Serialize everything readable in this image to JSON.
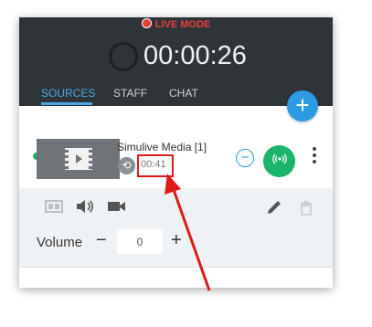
{
  "live_mode": {
    "label": "LIVE MODE",
    "color": "#e8403a"
  },
  "timer": {
    "value": "00:00:26"
  },
  "tabs": [
    {
      "label": "SOURCES",
      "active": true
    },
    {
      "label": "STAFF",
      "active": false
    },
    {
      "label": "CHAT",
      "active": false
    }
  ],
  "add_button": {
    "icon": "plus-icon",
    "label": "+"
  },
  "source": {
    "title": "Simulive Media [1]",
    "duration": "00:41",
    "status_color": "#1cb36b",
    "thumbnail_icon": "film-icon",
    "loop_icon": "loop-icon",
    "remove_icon": "minus-icon",
    "remove_label": "−",
    "broadcast_icon": "broadcast-icon",
    "more_icon": "more-vert-icon"
  },
  "toolbar": {
    "icons": [
      "layout-icon",
      "speaker-icon",
      "camera-icon",
      "pencil-icon",
      "trash-icon"
    ]
  },
  "volume": {
    "label": "Volume",
    "minus": "−",
    "value": "0",
    "plus": "+"
  },
  "colors": {
    "accent": "#2b9be3",
    "live_green": "#1cb36b",
    "header_bg": "#2f3438",
    "highlight": "#e01a1a"
  }
}
